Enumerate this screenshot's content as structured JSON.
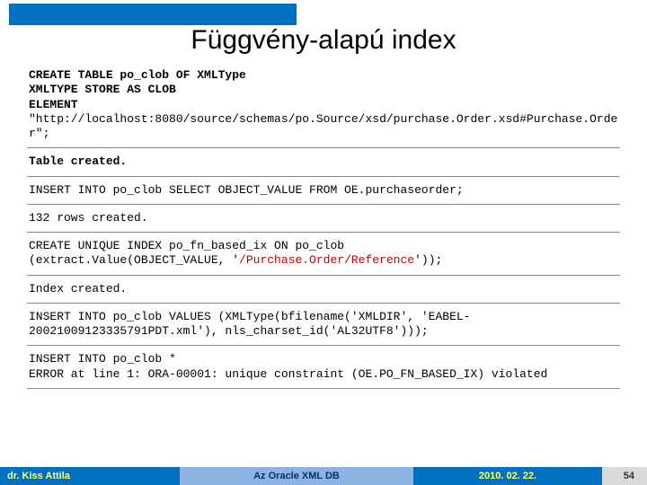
{
  "title": "Függvény-alapú index",
  "blocks": {
    "b1_l1": "CREATE TABLE po_clob OF XMLType",
    "b1_l2": "XMLTYPE STORE AS CLOB",
    "b1_l3": "ELEMENT",
    "b1_l4": "\"http://localhost:8080/source/schemas/po.Source/xsd/purchase.Order.xsd#Purchase.Order\";",
    "b2": "Table created.",
    "b3": "INSERT INTO po_clob SELECT OBJECT_VALUE FROM OE.purchaseorder;",
    "b4": "132 rows created.",
    "b5_l1": "CREATE UNIQUE INDEX po_fn_based_ix ON po_clob",
    "b5_l2a": "(extract.Value(OBJECT_VALUE, '",
    "b5_path": "/Purchase.Order/Reference",
    "b5_l2b": "'));",
    "b6": "Index created.",
    "b7": "INSERT INTO po_clob VALUES (XMLType(bfilename('XMLDIR', 'EABEL-20021009123335791PDT.xml'), nls_charset_id('AL32UTF8')));",
    "b8_l1": "INSERT INTO po_clob *",
    "b8_l2": "ERROR at line 1: ORA-00001: unique constraint (OE.PO_FN_BASED_IX) violated"
  },
  "footer": {
    "author": "dr. Kiss Attila",
    "subject": "Az Oracle XML DB",
    "date": "2010. 02. 22.",
    "page": "54"
  }
}
